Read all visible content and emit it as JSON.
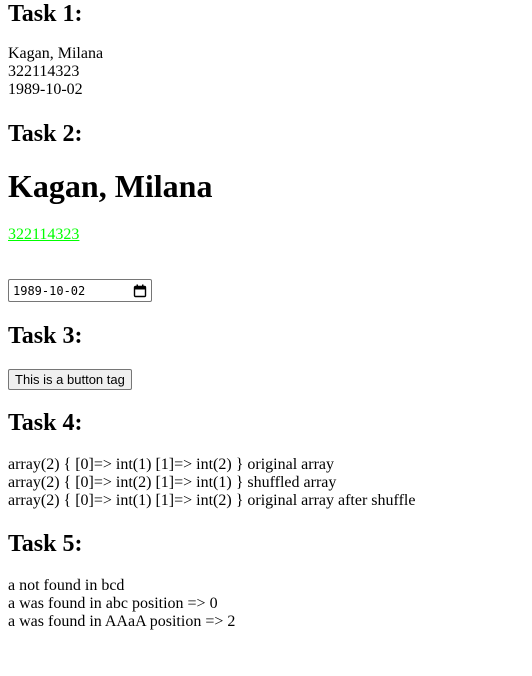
{
  "task1": {
    "heading": "Task 1:",
    "name": "Kagan, Milana",
    "id": "322114323",
    "date": "1989-10-02"
  },
  "task2": {
    "heading": "Task 2:",
    "name_heading": "Kagan, Milana",
    "link_text": "322114323",
    "link_color": "#00ff00",
    "date_value": "1989-10-02"
  },
  "task3": {
    "heading": "Task 3:",
    "button_label": "This is a button tag"
  },
  "task4": {
    "heading": "Task 4:",
    "lines": [
      "array(2) { [0]=> int(1) [1]=> int(2) } original array",
      "array(2) { [0]=> int(2) [1]=> int(1) } shuffled array",
      "array(2) { [0]=> int(1) [1]=> int(2) } original array after shuffle"
    ]
  },
  "task5": {
    "heading": "Task 5:",
    "lines": [
      "a not found in bcd",
      "a was found in abc position => 0",
      "a was found in AAaA position => 2"
    ]
  },
  "icons": {
    "date_picker": "calendar-icon"
  }
}
